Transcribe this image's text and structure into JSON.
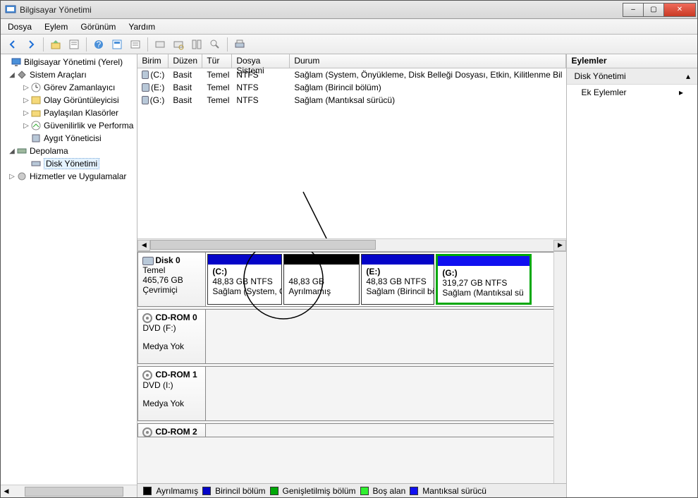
{
  "window": {
    "title": "Bilgisayar Yönetimi"
  },
  "menu": {
    "file": "Dosya",
    "action": "Eylem",
    "view": "Görünüm",
    "help": "Yardım"
  },
  "tree": {
    "root": "Bilgisayar Yönetimi (Yerel)",
    "system_tools": "Sistem Araçları",
    "task_scheduler": "Görev Zamanlayıcı",
    "event_viewer": "Olay Görüntüleyicisi",
    "shared_folders": "Paylaşılan Klasörler",
    "perf": "Güvenilirlik ve Performa",
    "device_mgr": "Aygıt Yöneticisi",
    "storage": "Depolama",
    "disk_mgmt": "Disk Yönetimi",
    "services": "Hizmetler ve Uygulamalar"
  },
  "vol_columns": {
    "volume": "Birim",
    "layout": "Düzen",
    "type": "Tür",
    "fs": "Dosya Sistemi",
    "status": "Durum"
  },
  "vol_rows": [
    {
      "volume": "(C:)",
      "layout": "Basit",
      "type": "Temel",
      "fs": "NTFS",
      "status": "Sağlam (System, Önyükleme, Disk Belleği Dosyası, Etkin, Kilitlenme Bil"
    },
    {
      "volume": "(E:)",
      "layout": "Basit",
      "type": "Temel",
      "fs": "NTFS",
      "status": "Sağlam (Birincil bölüm)"
    },
    {
      "volume": "(G:)",
      "layout": "Basit",
      "type": "Temel",
      "fs": "NTFS",
      "status": "Sağlam (Mantıksal sürücü)"
    }
  ],
  "disks": {
    "disk0": {
      "name": "Disk 0",
      "type": "Temel",
      "size": "465,76 GB",
      "state": "Çevrimiçi"
    },
    "cdrom0": {
      "name": "CD-ROM 0",
      "sub": "DVD (F:)",
      "nomedia": "Medya Yok"
    },
    "cdrom1": {
      "name": "CD-ROM 1",
      "sub": "DVD (I:)",
      "nomedia": "Medya Yok"
    },
    "cdrom2": {
      "name": "CD-ROM 2"
    }
  },
  "parts": {
    "c": {
      "name": "(C:)",
      "size": "48,83 GB NTFS",
      "status": "Sağlam (System, Ç"
    },
    "unalloc": {
      "size": "48,83 GB",
      "status": "Ayrılmamış"
    },
    "e": {
      "name": "(E:)",
      "size": "48,83 GB NTFS",
      "status": "Sağlam (Birincil bö"
    },
    "g": {
      "name": "(G:)",
      "size": "319,27 GB NTFS",
      "status": "Sağlam (Mantıksal sü"
    }
  },
  "legend": {
    "unallocated": "Ayrılmamış",
    "primary": "Birincil bölüm",
    "extended": "Genişletilmiş bölüm",
    "free": "Boş alan",
    "logical": "Mantıksal sürücü"
  },
  "actions": {
    "header": "Eylemler",
    "disk_mgmt": "Disk Yönetimi",
    "more": "Ek Eylemler"
  },
  "colors": {
    "primary": "#0404c8",
    "unallocated": "#000000",
    "extended": "#00a808",
    "free": "#30f030",
    "logical": "#1010f0"
  }
}
